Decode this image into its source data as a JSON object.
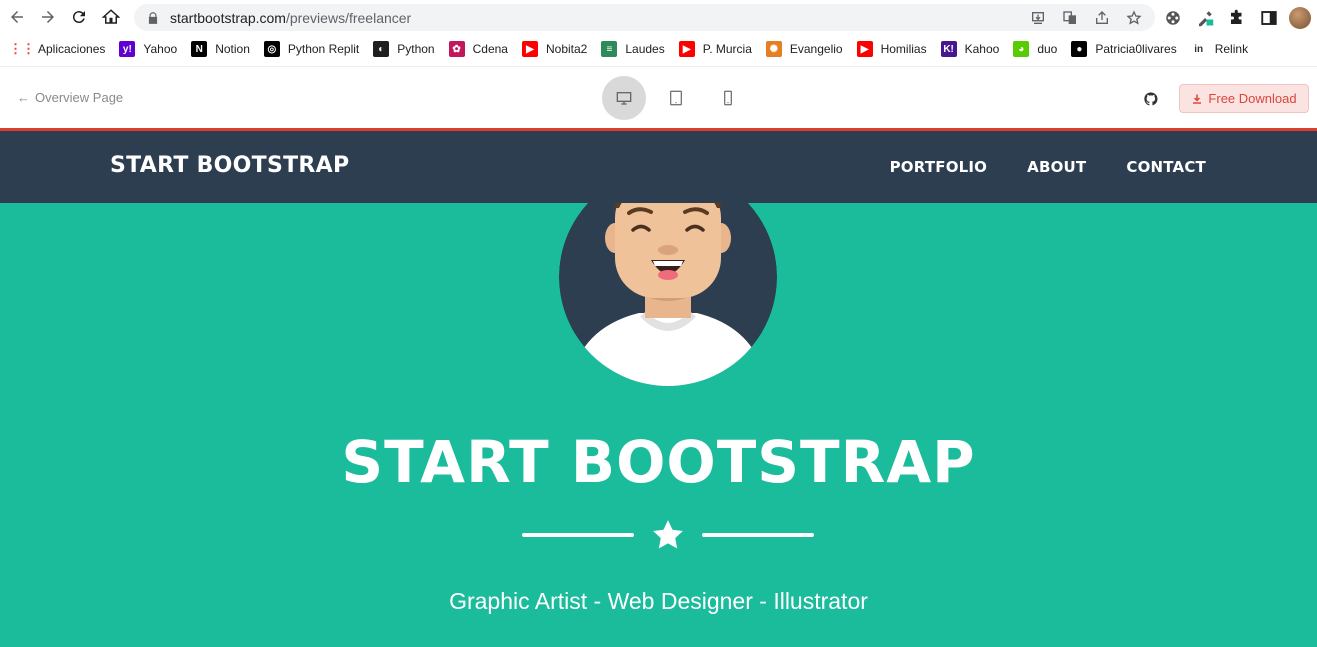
{
  "browser": {
    "url_host": "startbootstrap.com",
    "url_path": "/previews/freelancer"
  },
  "bookmarks": [
    {
      "label": "Aplicaciones",
      "icon": "apps-grid-icon",
      "color": "#4285f4"
    },
    {
      "label": "Yahoo",
      "icon": "yahoo-icon",
      "color": "#6001d2"
    },
    {
      "label": "Notion",
      "icon": "notion-icon",
      "color": "#000000"
    },
    {
      "label": "Python Replit",
      "icon": "replit-icon",
      "color": "#000000"
    },
    {
      "label": "Python",
      "icon": "python-icon",
      "color": "#1f1f1f"
    },
    {
      "label": "Cdena",
      "icon": "cdena-icon",
      "color": "#c2185b"
    },
    {
      "label": "Nobita2",
      "icon": "youtube-icon",
      "color": "#ff0000"
    },
    {
      "label": "Laudes",
      "icon": "laudes-icon",
      "color": "#2e8b57"
    },
    {
      "label": "P. Murcia",
      "icon": "youtube-icon",
      "color": "#ff0000"
    },
    {
      "label": "Evangelio",
      "icon": "evangelio-icon",
      "color": "#e67e22"
    },
    {
      "label": "Homilias",
      "icon": "youtube-icon",
      "color": "#ff0000"
    },
    {
      "label": "Kahoo",
      "icon": "kahoot-icon",
      "color": "#46178f"
    },
    {
      "label": "duo",
      "icon": "duolingo-icon",
      "color": "#58cc02"
    },
    {
      "label": "Patricia0livares",
      "icon": "github-icon",
      "color": "#000000"
    },
    {
      "label": "Relink",
      "icon": "relink-icon",
      "color": "#333333"
    }
  ],
  "preview_bar": {
    "overview_label": "Overview Page",
    "download_label": "Free Download"
  },
  "site": {
    "brand": "START BOOTSTRAP",
    "nav": [
      "PORTFOLIO",
      "ABOUT",
      "CONTACT"
    ],
    "hero_title": "START BOOTSTRAP",
    "hero_subtitle": "Graphic Artist - Web Designer - Illustrator"
  },
  "colors": {
    "navbar": "#2c3e50",
    "hero": "#1abc9c",
    "accent_red": "#dc3f2f"
  }
}
